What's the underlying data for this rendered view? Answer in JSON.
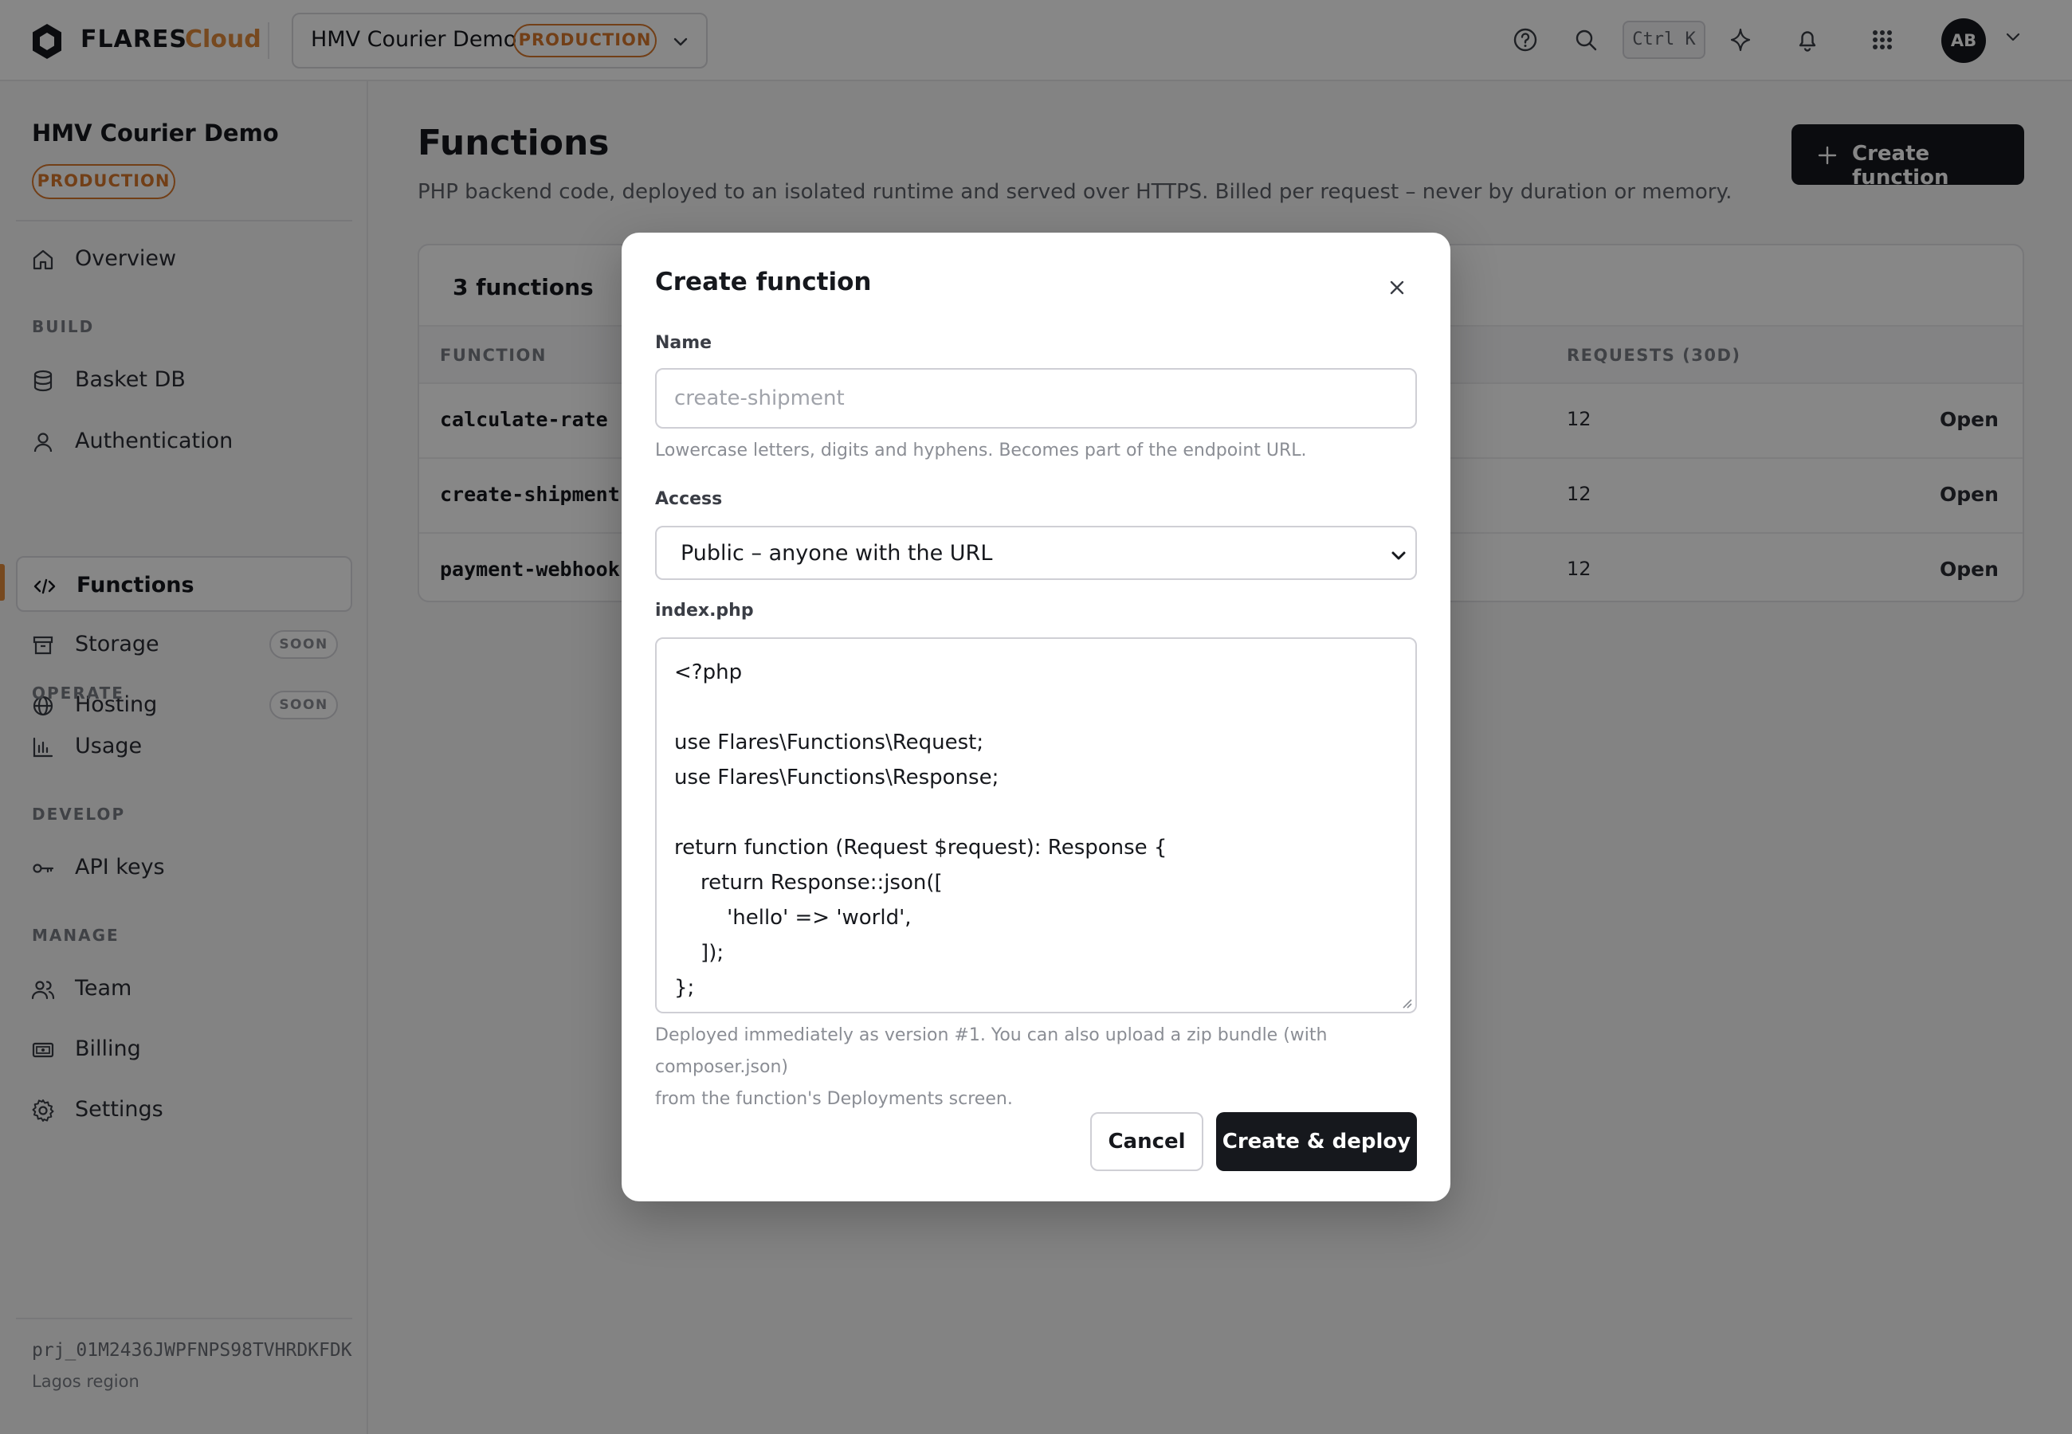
{
  "topbar": {
    "brand": "FLARES",
    "brand_suffix": "Cloud",
    "project_name": "HMV Courier Demo",
    "environment": "PRODUCTION",
    "shortcut": "Ctrl K",
    "avatar_initials": "AB",
    "icons": [
      "help-icon",
      "search-icon",
      "sparkle-icon",
      "bell-icon",
      "apps-grid-icon",
      "chevron-down-icon"
    ]
  },
  "sidebar": {
    "project_name": "HMV Courier Demo",
    "environment": "PRODUCTION",
    "overview": "Overview",
    "sections": {
      "build": "BUILD",
      "operate": "OPERATE",
      "develop": "DEVELOP",
      "manage": "MANAGE"
    },
    "items": {
      "basket_db": "Basket DB",
      "authentication": "Authentication",
      "functions": "Functions",
      "storage": "Storage",
      "hosting": "Hosting",
      "usage": "Usage",
      "api_keys": "API keys",
      "team": "Team",
      "billing": "Billing",
      "settings": "Settings"
    },
    "soon_badge": "SOON",
    "active_item": "Functions",
    "footer": {
      "project_id": "prj_01M2436JWPFNPS98TVHRDKFDK",
      "region": "Lagos region"
    }
  },
  "main": {
    "title": "Functions",
    "subtitle": "PHP backend code, deployed to an isolated runtime and served over HTTPS. Billed per request – never by duration or memory.",
    "create_button": "Create function",
    "table": {
      "count_label": "3 functions",
      "columns": {
        "function": "FUNCTION",
        "requests": "REQUESTS (30D)"
      },
      "rows": [
        {
          "name": "calculate-rate",
          "requests": "12",
          "action": "Open"
        },
        {
          "name": "create-shipment",
          "requests": "12",
          "action": "Open"
        },
        {
          "name": "payment-webhook",
          "requests": "12",
          "action": "Open"
        }
      ]
    }
  },
  "modal": {
    "title": "Create function",
    "name_label": "Name",
    "name_value": "",
    "name_placeholder": "create-shipment",
    "name_hint": "Lowercase letters, digits and hyphens. Becomes part of the endpoint URL.",
    "access_label": "Access",
    "access_value": "Public – anyone with the URL",
    "code_label": "index.php",
    "code_lines": [
      "<?php",
      "",
      "use Flares\\Functions\\Request;",
      "use Flares\\Functions\\Response;",
      "",
      "return function (Request $request): Response {",
      "    return Response::json([",
      "        'hello' => 'world',",
      "    ]);",
      "};"
    ],
    "deploy_hint_line1": "Deployed immediately as version #1. You can also upload a zip bundle (with composer.json)",
    "deploy_hint_line2": "from the function's Deployments screen.",
    "cancel_label": "Cancel",
    "submit_label": "Create & deploy"
  }
}
